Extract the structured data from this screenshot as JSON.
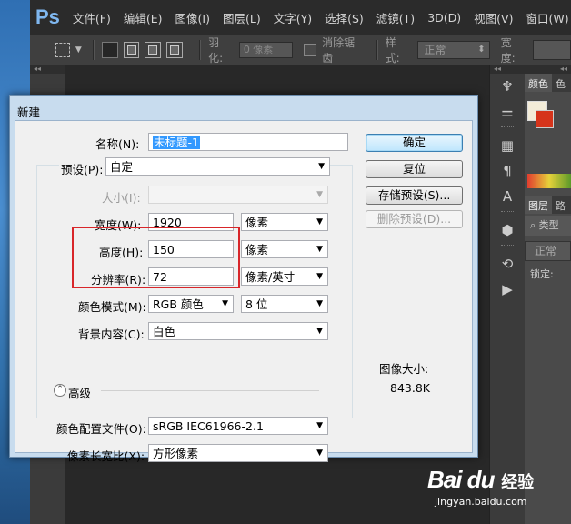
{
  "menubar": {
    "logo": "Ps",
    "items": [
      "文件(F)",
      "编辑(E)",
      "图像(I)",
      "图层(L)",
      "文字(Y)",
      "选择(S)",
      "滤镜(T)",
      "3D(D)",
      "视图(V)",
      "窗口(W)"
    ]
  },
  "options": {
    "feather_label": "羽化:",
    "feather_value": "0 像素",
    "antialias_label": "消除锯齿",
    "style_label": "样式:",
    "style_value": "正常",
    "width_label": "宽度:"
  },
  "right_panel": {
    "color_tabs": [
      "颜色",
      "色"
    ],
    "layer_tabs": [
      "图层",
      "路"
    ],
    "search_text": "⌕ 类型",
    "blend_mode": "正常",
    "lock_label": "锁定:"
  },
  "dialog": {
    "title": "新建",
    "name_label": "名称(N):",
    "name_value": "未标题-1",
    "preset_label": "预设(P):",
    "preset_value": "自定",
    "size_label": "大小(I):",
    "width_label": "宽度(W):",
    "width_value": "1920",
    "width_unit": "像素",
    "height_label": "高度(H):",
    "height_value": "150",
    "height_unit": "像素",
    "resolution_label": "分辨率(R):",
    "resolution_value": "72",
    "resolution_unit": "像素/英寸",
    "color_mode_label": "颜色模式(M):",
    "color_mode_value": "RGB 颜色",
    "bit_depth_value": "8 位",
    "background_label": "背景内容(C):",
    "background_value": "白色",
    "advanced_label": "高级",
    "color_profile_label": "颜色配置文件(O):",
    "color_profile_value": "sRGB IEC61966-2.1",
    "pixel_aspect_label": "像素长宽比(X):",
    "pixel_aspect_value": "方形像素",
    "ok_button": "确定",
    "reset_button": "复位",
    "save_preset_button": "存储预设(S)...",
    "delete_preset_button": "删除预设(D)...",
    "image_size_label": "图像大小:",
    "image_size_value": "843.8K"
  },
  "watermark": {
    "logo": "Bai du",
    "brand_cn": "经验",
    "url": "jingyan.baidu.com"
  }
}
